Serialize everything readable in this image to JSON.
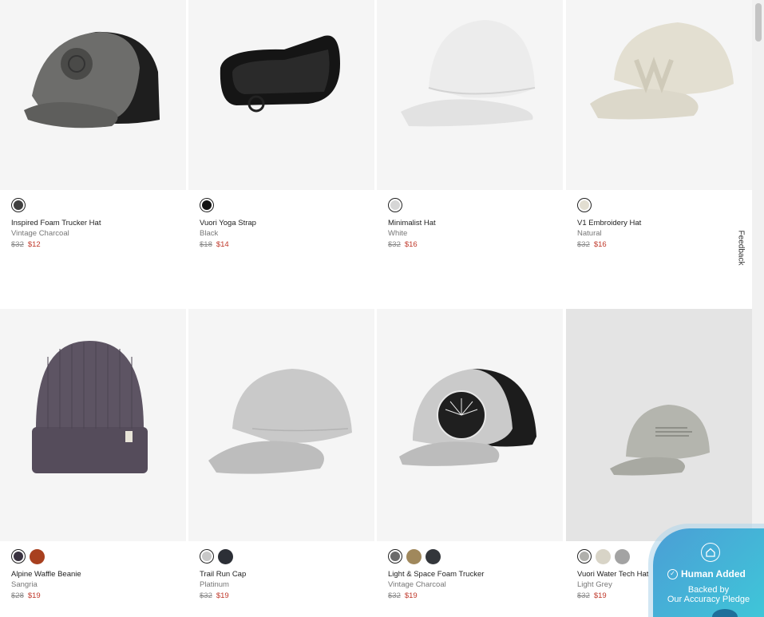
{
  "products": [
    {
      "name": "Inspired Foam Trucker Hat",
      "color": "Vintage Charcoal",
      "price_original": "$32",
      "price_sale": "$12",
      "swatches": [
        "#3f3f3f"
      ]
    },
    {
      "name": "Vuori Yoga Strap",
      "color": "Black",
      "price_original": "$18",
      "price_sale": "$14",
      "swatches": [
        "#111111"
      ]
    },
    {
      "name": "Minimalist Hat",
      "color": "White",
      "price_original": "$32",
      "price_sale": "$16",
      "swatches": [
        "#d6d6d6"
      ]
    },
    {
      "name": "V1 Embroidery Hat",
      "color": "Natural",
      "price_original": "$32",
      "price_sale": "$16",
      "swatches": [
        "#e2ded1"
      ]
    },
    {
      "name": "Alpine Waffle Beanie",
      "color": "Sangria",
      "price_original": "$28",
      "price_sale": "$19",
      "swatches": [
        "#3a3340",
        "#a8401f"
      ]
    },
    {
      "name": "Trail Run Cap",
      "color": "Platinum",
      "price_original": "$32",
      "price_sale": "$19",
      "swatches": [
        "#c8c8c8",
        "#2c2f36"
      ]
    },
    {
      "name": "Light & Space Foam Trucker",
      "color": "Vintage Charcoal",
      "price_original": "$32",
      "price_sale": "$19",
      "swatches": [
        "#6b6b6b",
        "#a0885c",
        "#33363b"
      ]
    },
    {
      "name": "Vuori Water Tech Hat",
      "color": "Light Grey",
      "price_original": "$32",
      "price_sale": "$19",
      "swatches": [
        "#b0b0ac",
        "#d8d4c7",
        "#a3a3a3"
      ]
    }
  ],
  "feedback_label": "Feedback",
  "trust_badge": {
    "title": "Human Added",
    "line1": "Backed by",
    "line2": "Our Accuracy Pledge"
  },
  "colors": {
    "sale_price": "#c0392b",
    "badge_start": "#4b9ed6",
    "badge_end": "#3fc6d8"
  },
  "icons": {
    "home": "home-icon",
    "check": "check-circle-icon"
  }
}
